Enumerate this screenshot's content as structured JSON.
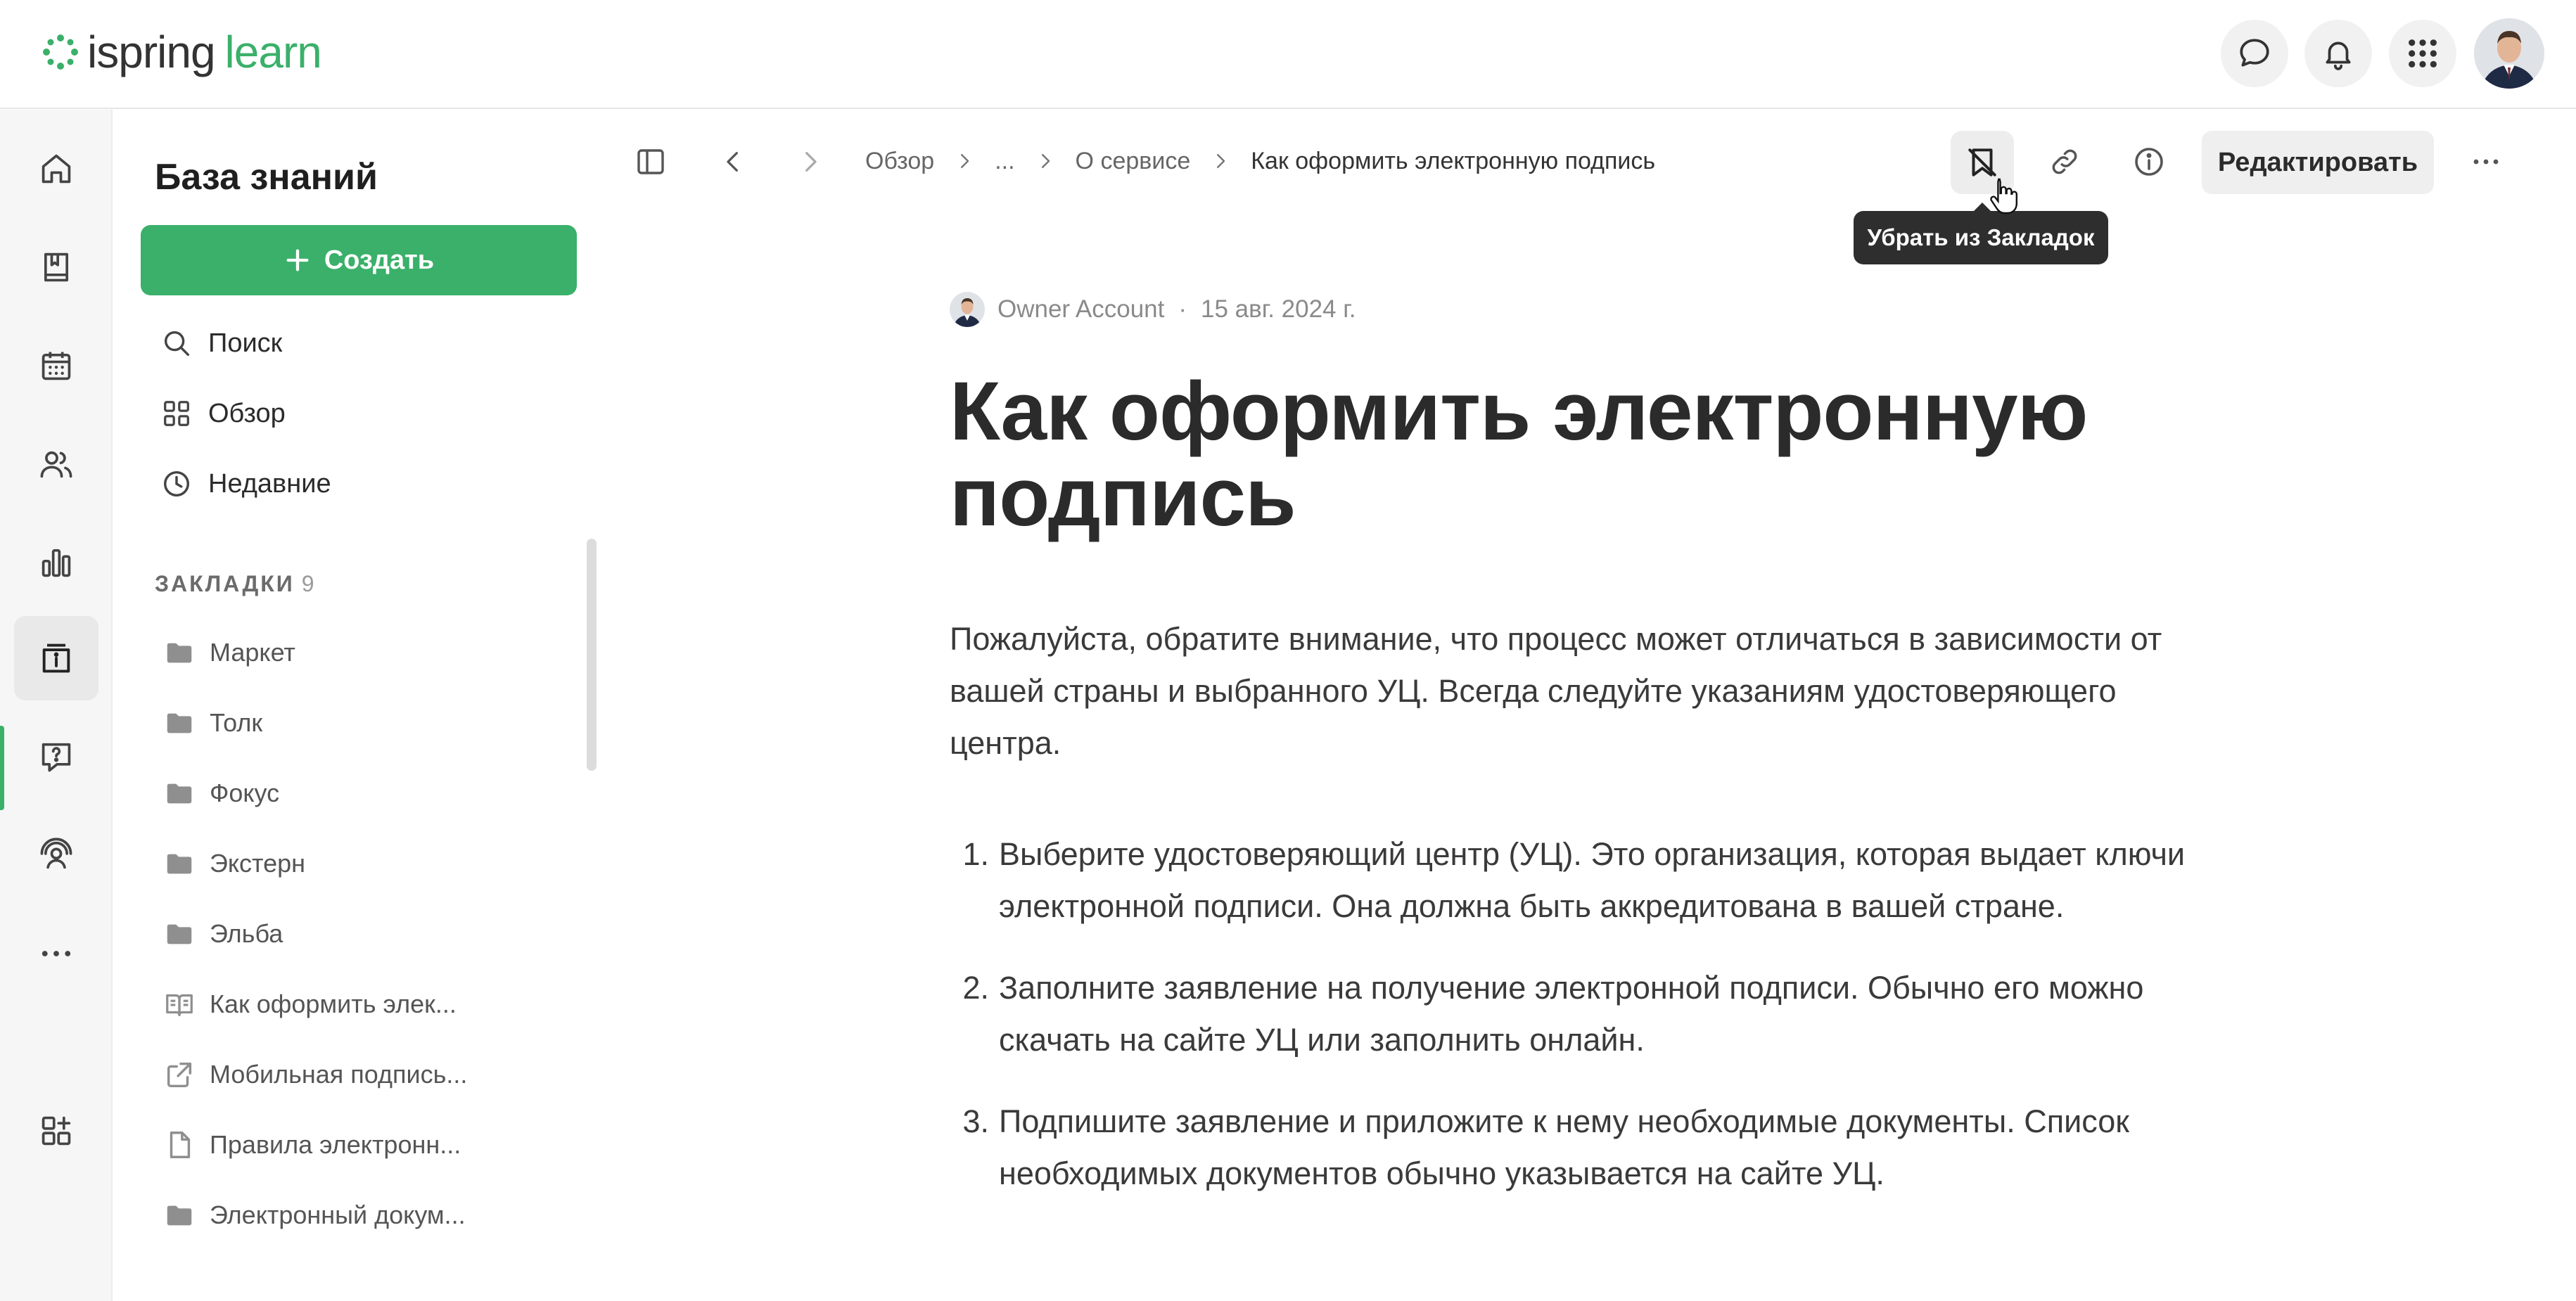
{
  "header": {
    "logo": {
      "brand": "ispring",
      "product": "learn"
    },
    "accent": "#3ab06a",
    "icons": [
      "chat-icon",
      "bell-icon",
      "apps-grid-icon"
    ]
  },
  "rail": {
    "items": [
      "home-icon",
      "library-icon",
      "calendar-icon",
      "users-icon",
      "reports-icon",
      "knowledge-base-icon",
      "help-icon",
      "webinar-icon",
      "more-icon",
      "add-widget-icon"
    ],
    "active": "knowledge-base-icon"
  },
  "sidebar": {
    "title": "База знаний",
    "create_label": "Создать",
    "links": [
      {
        "label": "Поиск",
        "icon": "search-icon"
      },
      {
        "label": "Обзор",
        "icon": "grid-icon"
      },
      {
        "label": "Недавние",
        "icon": "clock-icon"
      }
    ],
    "bookmarks_label": "ЗАКЛАДКИ",
    "bookmarks_count": "9",
    "bookmarks": [
      {
        "label": "Маркет",
        "icon": "folder-icon"
      },
      {
        "label": "Толк",
        "icon": "folder-icon"
      },
      {
        "label": "Фокус",
        "icon": "folder-icon"
      },
      {
        "label": "Экстерн",
        "icon": "folder-icon"
      },
      {
        "label": "Эльба",
        "icon": "folder-icon"
      },
      {
        "label": "Как оформить элек...",
        "icon": "book-icon"
      },
      {
        "label": "Мобильная подпись...",
        "icon": "external-link-icon"
      },
      {
        "label": "Правила электронн...",
        "icon": "document-icon"
      },
      {
        "label": "Электронный докум...",
        "icon": "folder-icon"
      }
    ]
  },
  "toolbar": {
    "breadcrumb": [
      "Обзор",
      "...",
      "О сервисе",
      "Как оформить электронную подпись"
    ],
    "edit_label": "Редактировать",
    "tooltip": "Убрать из Закладок"
  },
  "article": {
    "author": "Owner Account",
    "date": "15 авг. 2024 г.",
    "title": "Как оформить электронную подпись",
    "intro": "Пожалуйста, обратите внимание, что процесс может отличаться в зависимости от вашей страны и выбранного УЦ. Всегда следуйте указаниям удостоверяющего центра.",
    "steps": [
      {
        "num": "1.",
        "text": "Выберите удостоверяющий центр (УЦ). Это организация, которая выдает ключи электронной подписи. Она должна быть аккредитована в вашей стране."
      },
      {
        "num": "2.",
        "text": "Заполните заявление на получение электронной подписи. Обычно его можно скачать на сайте УЦ или заполнить онлайн."
      },
      {
        "num": "3.",
        "text": "Подпишите заявление и приложите к нему необходимые документы. Список необходимых документов обычно указывается на сайте УЦ."
      }
    ]
  }
}
